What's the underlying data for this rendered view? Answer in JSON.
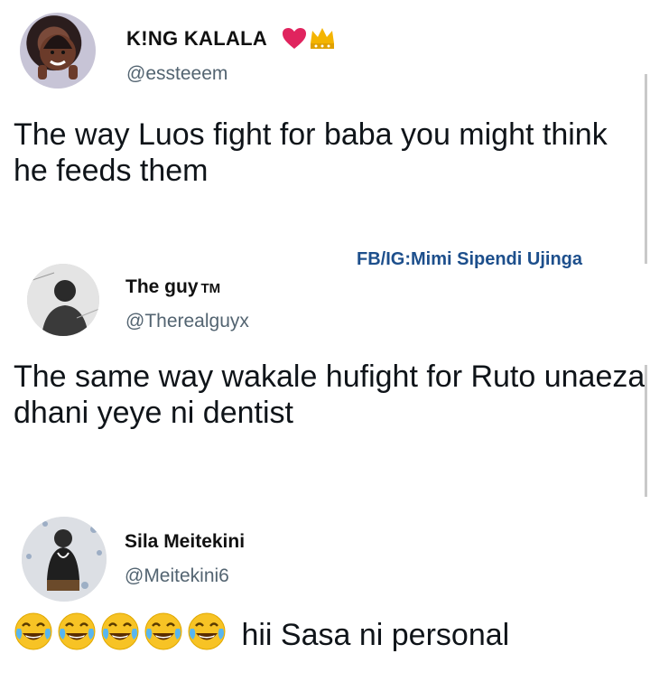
{
  "tweets": [
    {
      "name": "K!NG KALALA",
      "handle": "@essteeem",
      "text": "The way Luos fight for baba you might think he feeds them"
    },
    {
      "name": "The guy",
      "name_suffix": "TM",
      "handle": "@Therealguyx",
      "text": "The same way wakale hufight for Ruto unaeza dhani yeye ni dentist"
    },
    {
      "name": "Sila Meitekini",
      "handle": "@Meitekini6",
      "text": "hii Sasa ni personal",
      "emoji_count": 5
    }
  ],
  "watermark": "FB/IG:Mimi Sipendi Ujinga",
  "colors": {
    "handle": "#536471",
    "watermark": "#1d4f8c",
    "heart": "#e0245e",
    "crown": "#f4b400"
  },
  "icons": [
    "heart-icon",
    "crown-icon",
    "joy-emoji-icon"
  ]
}
